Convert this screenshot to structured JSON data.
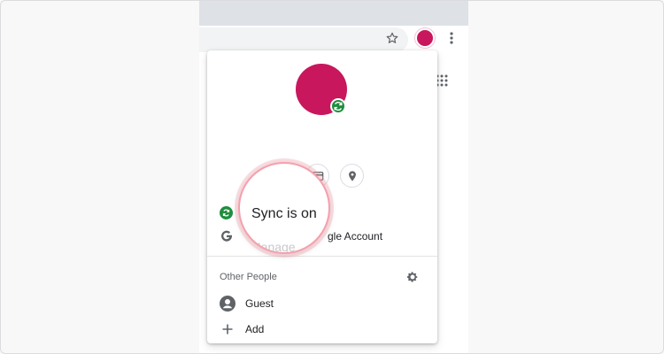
{
  "popup": {
    "sync_status": "Sync is on",
    "account_link_partial": "gle Account",
    "account_link_ghost": "Manage",
    "other_people_title": "Other People",
    "people": [
      {
        "label": "Guest"
      },
      {
        "label": "Add"
      }
    ]
  },
  "icons": {
    "star": "star-icon",
    "menu": "more-vert-icon",
    "apps": "apps-grid-icon",
    "sync": "sync-icon",
    "google": "google-g-icon",
    "gear": "gear-icon",
    "guest": "person-icon",
    "add": "plus-icon",
    "payment": "credit-card-icon",
    "address": "location-pin-icon"
  },
  "colors": {
    "avatar": "#c8175d",
    "sync_green": "#1e8e3e",
    "highlight_ring": "#f4a0ad"
  }
}
